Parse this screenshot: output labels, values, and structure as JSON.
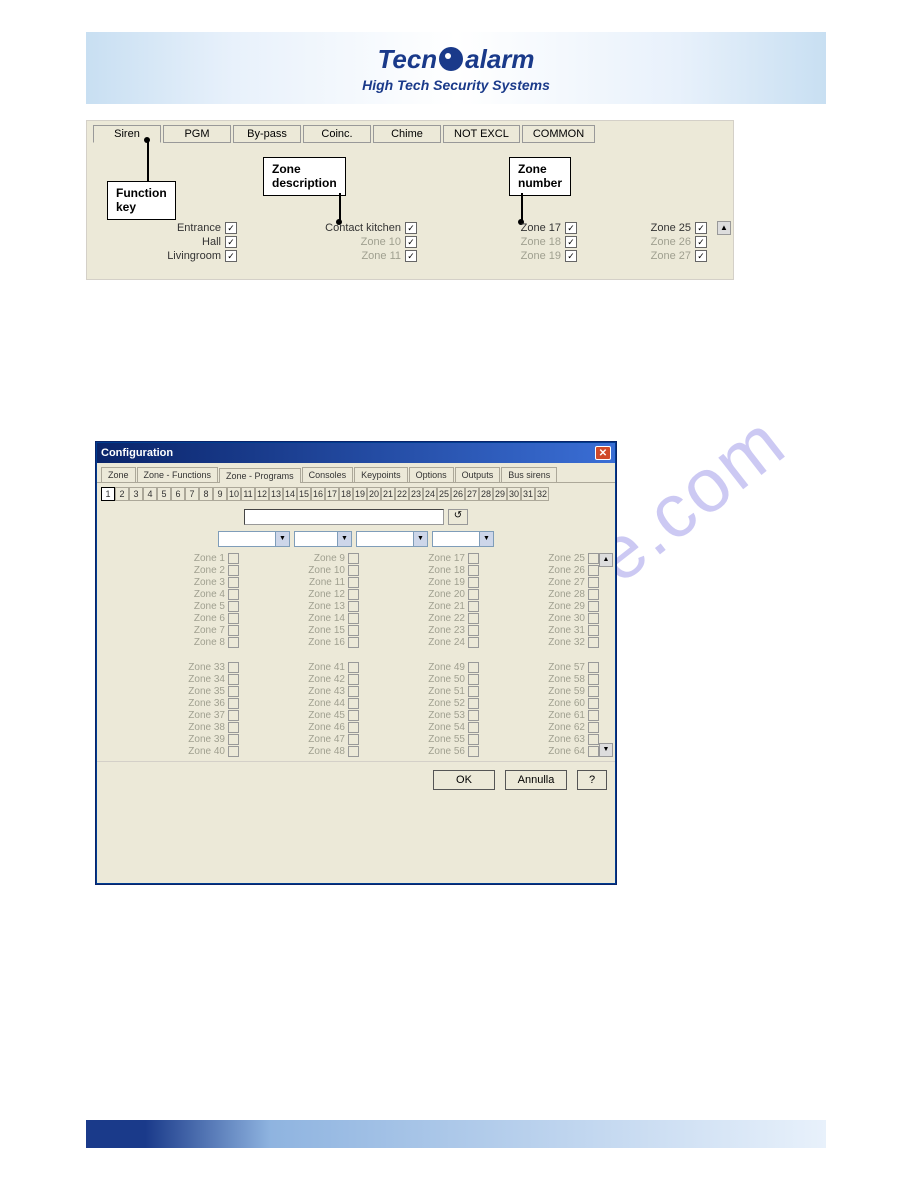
{
  "header": {
    "logo_text_pre": "Tecn",
    "logo_text_post": "alarm",
    "subtitle": "High Tech Security Systems"
  },
  "shot1": {
    "tabs": [
      "Siren",
      "PGM",
      "By-pass",
      "Coinc.",
      "Chime",
      "NOT EXCL",
      "COMMON"
    ],
    "callouts": {
      "function_key": "Function\nkey",
      "zone_description": "Zone\ndescription",
      "zone_number": "Zone\nnumber"
    },
    "rows": [
      {
        "c1": "Entrance",
        "c2": "Contact kitchen",
        "c3": "Zone 17",
        "c4": "Zone 25",
        "active": true
      },
      {
        "c1": "Hall",
        "c2": "Zone 10",
        "c3": "Zone 18",
        "c4": "Zone 26",
        "active_c1": true
      },
      {
        "c1": "Livingroom",
        "c2": "Zone 11",
        "c3": "Zone 19",
        "c4": "Zone 27",
        "active_c1": true
      }
    ]
  },
  "watermark": "manualshive.com",
  "shot2": {
    "title": "Configuration",
    "tabs": [
      "Zone",
      "Zone - Functions",
      "Zone - Programs",
      "Consoles",
      "Keypoints",
      "Options",
      "Outputs",
      "Bus sirens"
    ],
    "active_tab": "Zone - Programs",
    "num_tabs": [
      "1",
      "2",
      "3",
      "4",
      "5",
      "6",
      "7",
      "8",
      "9",
      "10",
      "11",
      "12",
      "13",
      "14",
      "15",
      "16",
      "17",
      "18",
      "19",
      "20",
      "21",
      "22",
      "23",
      "24",
      "25",
      "26",
      "27",
      "28",
      "29",
      "30",
      "31",
      "32"
    ],
    "zones_a": [
      [
        "Zone 1",
        "Zone 9",
        "Zone 17",
        "Zone 25"
      ],
      [
        "Zone 2",
        "Zone 10",
        "Zone 18",
        "Zone 26"
      ],
      [
        "Zone 3",
        "Zone 11",
        "Zone 19",
        "Zone 27"
      ],
      [
        "Zone 4",
        "Zone 12",
        "Zone 20",
        "Zone 28"
      ],
      [
        "Zone 5",
        "Zone 13",
        "Zone 21",
        "Zone 29"
      ],
      [
        "Zone 6",
        "Zone 14",
        "Zone 22",
        "Zone 30"
      ],
      [
        "Zone 7",
        "Zone 15",
        "Zone 23",
        "Zone 31"
      ],
      [
        "Zone 8",
        "Zone 16",
        "Zone 24",
        "Zone 32"
      ]
    ],
    "zones_b": [
      [
        "Zone 33",
        "Zone 41",
        "Zone 49",
        "Zone 57"
      ],
      [
        "Zone 34",
        "Zone 42",
        "Zone 50",
        "Zone 58"
      ],
      [
        "Zone 35",
        "Zone 43",
        "Zone 51",
        "Zone 59"
      ],
      [
        "Zone 36",
        "Zone 44",
        "Zone 52",
        "Zone 60"
      ],
      [
        "Zone 37",
        "Zone 45",
        "Zone 53",
        "Zone 61"
      ],
      [
        "Zone 38",
        "Zone 46",
        "Zone 54",
        "Zone 62"
      ],
      [
        "Zone 39",
        "Zone 47",
        "Zone 55",
        "Zone 63"
      ],
      [
        "Zone 40",
        "Zone 48",
        "Zone 56",
        "Zone 64"
      ]
    ],
    "buttons": {
      "ok": "OK",
      "cancel": "Annulla",
      "help": "?"
    },
    "reset_icon": "↺"
  }
}
